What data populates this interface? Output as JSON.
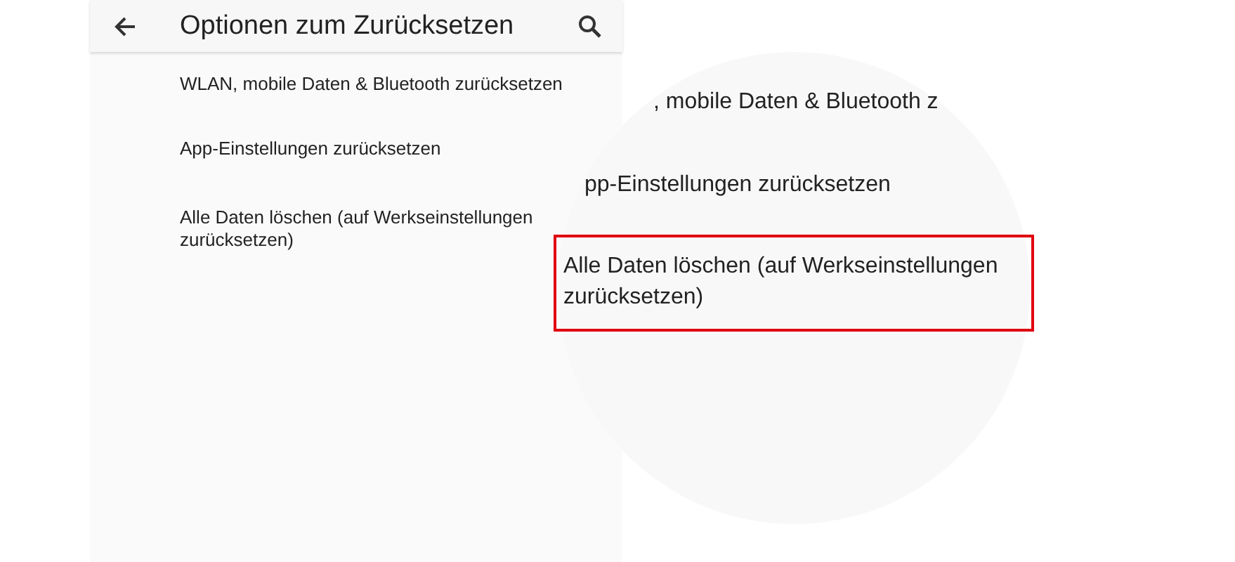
{
  "app_bar": {
    "title": "Optionen zum Zurücksetzen"
  },
  "items": [
    {
      "label": "WLAN, mobile Daten & Bluetooth zurücksetzen"
    },
    {
      "label": "App-Einstellungen zurücksetzen"
    },
    {
      "label": "Alle Daten löschen (auf Werkseinstellungen zurücksetzen)"
    }
  ],
  "magnifier": {
    "items": [
      {
        "label": ", mobile Daten & Bluetooth z",
        "highlighted": false
      },
      {
        "label": "pp-Einstellungen zurücksetzen",
        "highlighted": false
      },
      {
        "label": "Alle Daten löschen (auf Werkseinstellungen zurücksetzen)",
        "highlighted": true
      }
    ]
  }
}
